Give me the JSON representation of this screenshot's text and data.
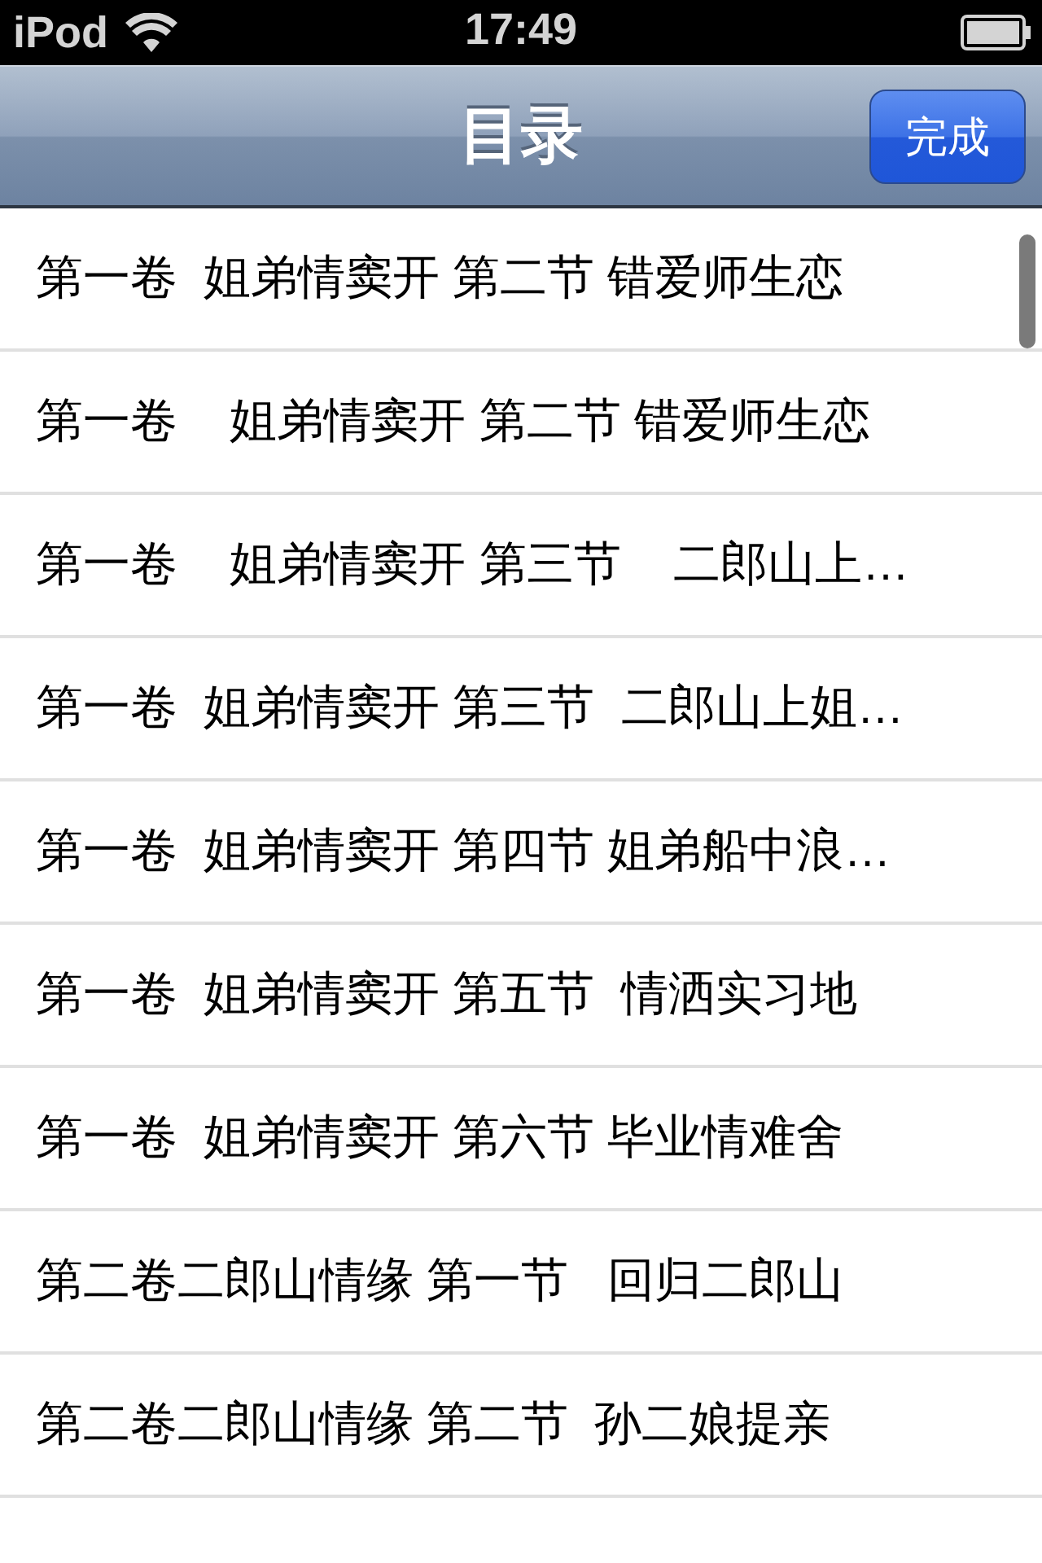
{
  "status_bar": {
    "carrier": "iPod",
    "time": "17:49"
  },
  "nav_bar": {
    "title": "目录",
    "done_button": "完成"
  },
  "chapters": [
    {
      "title": "第一卷  姐弟情窦开 第二节 错爱师生恋"
    },
    {
      "title": "第一卷    姐弟情窦开 第二节 错爱师生恋"
    },
    {
      "title": "第一卷    姐弟情窦开 第三节    二郎山上…"
    },
    {
      "title": "第一卷  姐弟情窦开 第三节  二郎山上姐…"
    },
    {
      "title": "第一卷  姐弟情窦开 第四节 姐弟船中浪…"
    },
    {
      "title": "第一卷  姐弟情窦开 第五节  情洒实习地"
    },
    {
      "title": "第一卷  姐弟情窦开 第六节 毕业情难舍"
    },
    {
      "title": "第二卷二郎山情缘 第一节   回归二郎山"
    },
    {
      "title": "第二卷二郎山情缘 第二节  孙二娘提亲"
    }
  ]
}
